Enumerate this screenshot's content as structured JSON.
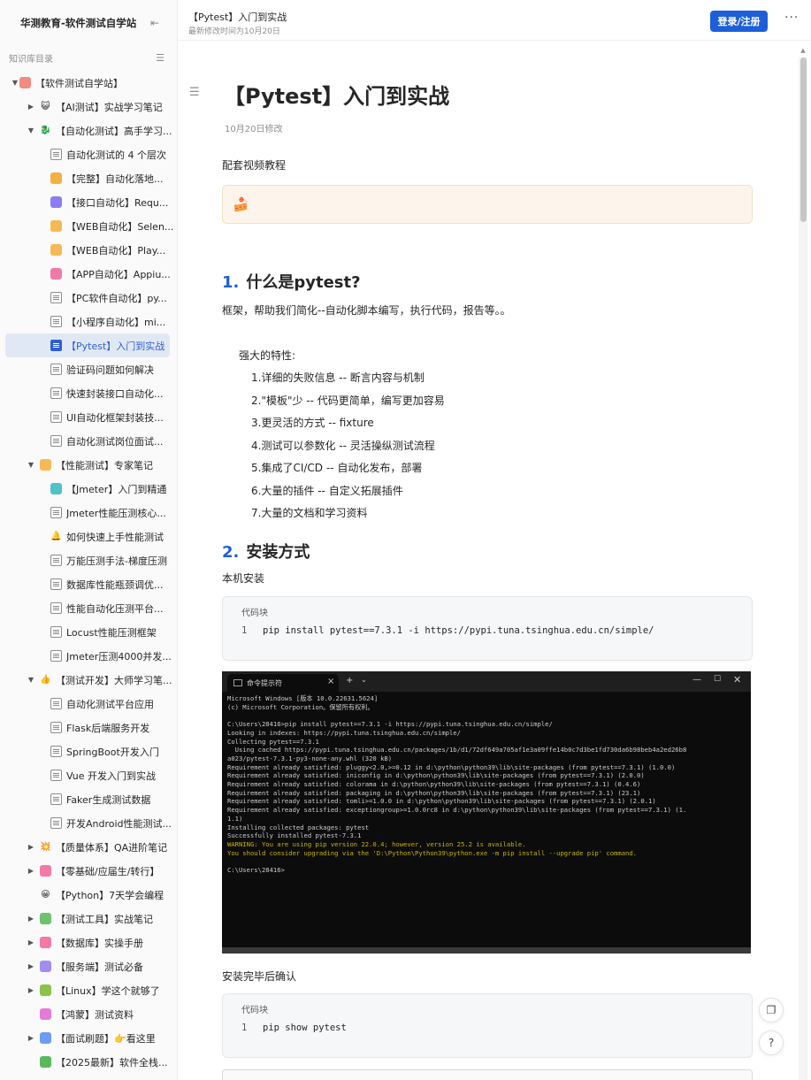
{
  "sidebar": {
    "title": "华测教育-软件测试自学站",
    "subtitle": "知识库目录",
    "items": [
      {
        "label": "【软件测试自学站】",
        "level": 0,
        "caret": "down",
        "icon": "root-icon",
        "icon_color": "#f28b82",
        "glyph": ""
      },
      {
        "label": "【AI测试】实战学习笔记",
        "level": 1,
        "caret": "right",
        "icon": "cat-icon",
        "icon_color": "",
        "glyph": "😺"
      },
      {
        "label": "【自动化测试】高手学习...",
        "level": 1,
        "caret": "down",
        "icon": "dragon-icon",
        "icon_color": "",
        "glyph": "🐉"
      },
      {
        "label": "自动化测试的 4 个层次",
        "level": 2,
        "caret": "",
        "icon": "doc",
        "icon_color": "",
        "glyph": ""
      },
      {
        "label": "【完整】自动化落地...",
        "level": 2,
        "caret": "",
        "icon": "orange-icon",
        "icon_color": "#f5b041",
        "glyph": ""
      },
      {
        "label": "【接口自动化】Requ...",
        "level": 2,
        "caret": "",
        "icon": "purple-icon",
        "icon_color": "#8e7cf5",
        "glyph": ""
      },
      {
        "label": "【WEB自动化】Selen...",
        "level": 2,
        "caret": "",
        "icon": "yellow-icon",
        "icon_color": "#f7b955",
        "glyph": ""
      },
      {
        "label": "【WEB自动化】Play...",
        "level": 2,
        "caret": "",
        "icon": "yellow-icon",
        "icon_color": "#f7b955",
        "glyph": ""
      },
      {
        "label": "【APP自动化】Appiu...",
        "level": 2,
        "caret": "",
        "icon": "pink-icon",
        "icon_color": "#f27aa6",
        "glyph": ""
      },
      {
        "label": "【PC软件自动化】py...",
        "level": 2,
        "caret": "",
        "icon": "doc",
        "icon_color": "",
        "glyph": ""
      },
      {
        "label": "【小程序自动化】mi...",
        "level": 2,
        "caret": "",
        "icon": "doc",
        "icon_color": "",
        "glyph": ""
      },
      {
        "label": "【Pytest】入门到实战",
        "level": 2,
        "caret": "",
        "icon": "doc-active",
        "icon_color": "",
        "glyph": "",
        "active": true
      },
      {
        "label": "验证码问题如何解决",
        "level": 2,
        "caret": "",
        "icon": "doc",
        "icon_color": "",
        "glyph": ""
      },
      {
        "label": "快速封装接口自动化...",
        "level": 2,
        "caret": "",
        "icon": "doc",
        "icon_color": "",
        "glyph": ""
      },
      {
        "label": "UI自动化框架封装技...",
        "level": 2,
        "caret": "",
        "icon": "doc",
        "icon_color": "",
        "glyph": ""
      },
      {
        "label": "自动化测试岗位面试...",
        "level": 2,
        "caret": "",
        "icon": "doc",
        "icon_color": "",
        "glyph": ""
      },
      {
        "label": "【性能测试】专家笔记",
        "level": 1,
        "caret": "down",
        "icon": "folder-icon",
        "icon_color": "#f7b955",
        "glyph": ""
      },
      {
        "label": "【Jmeter】入门到精通",
        "level": 2,
        "caret": "",
        "icon": "teal-icon",
        "icon_color": "#4fc3c8",
        "glyph": ""
      },
      {
        "label": "Jmeter性能压测核心...",
        "level": 2,
        "caret": "",
        "icon": "doc",
        "icon_color": "",
        "glyph": ""
      },
      {
        "label": "如何快速上手性能测试",
        "level": 2,
        "caret": "",
        "icon": "bell-icon",
        "icon_color": "",
        "glyph": "🔔"
      },
      {
        "label": "万能压测手法-梯度压测",
        "level": 2,
        "caret": "",
        "icon": "doc",
        "icon_color": "",
        "glyph": ""
      },
      {
        "label": "数据库性能瓶颈调优...",
        "level": 2,
        "caret": "",
        "icon": "doc",
        "icon_color": "",
        "glyph": ""
      },
      {
        "label": "性能自动化压测平台...",
        "level": 2,
        "caret": "",
        "icon": "doc",
        "icon_color": "",
        "glyph": ""
      },
      {
        "label": "Locust性能压测框架",
        "level": 2,
        "caret": "",
        "icon": "doc",
        "icon_color": "",
        "glyph": ""
      },
      {
        "label": "Jmeter压测4000并发...",
        "level": 2,
        "caret": "",
        "icon": "doc",
        "icon_color": "",
        "glyph": ""
      },
      {
        "label": "【测试开发】大师学习笔...",
        "level": 1,
        "caret": "down",
        "icon": "thumb-icon",
        "icon_color": "",
        "glyph": "👍"
      },
      {
        "label": "自动化测试平台应用",
        "level": 2,
        "caret": "",
        "icon": "doc",
        "icon_color": "",
        "glyph": ""
      },
      {
        "label": "Flask后端服务开发",
        "level": 2,
        "caret": "",
        "icon": "doc",
        "icon_color": "",
        "glyph": ""
      },
      {
        "label": "SpringBoot开发入门",
        "level": 2,
        "caret": "",
        "icon": "doc",
        "icon_color": "",
        "glyph": ""
      },
      {
        "label": "Vue 开发入门到实战",
        "level": 2,
        "caret": "",
        "icon": "doc",
        "icon_color": "",
        "glyph": ""
      },
      {
        "label": "Faker生成测试数据",
        "level": 2,
        "caret": "",
        "icon": "doc",
        "icon_color": "",
        "glyph": ""
      },
      {
        "label": "开发Android性能测试...",
        "level": 2,
        "caret": "",
        "icon": "doc",
        "icon_color": "",
        "glyph": ""
      },
      {
        "label": "【质量体系】QA进阶笔记",
        "level": 1,
        "caret": "right",
        "icon": "burst-icon",
        "icon_color": "",
        "glyph": "💥"
      },
      {
        "label": "【零基础/应届生/转行】",
        "level": 1,
        "caret": "right",
        "icon": "pink-icon",
        "icon_color": "#f27aa6",
        "glyph": ""
      },
      {
        "label": "【Python】7天学会编程",
        "level": 1,
        "caret": "",
        "icon": "smile-icon",
        "icon_color": "",
        "glyph": "😀"
      },
      {
        "label": "【测试工具】实战笔记",
        "level": 1,
        "caret": "right",
        "icon": "green-icon",
        "icon_color": "#6cc36c",
        "glyph": ""
      },
      {
        "label": "【数据库】实操手册",
        "level": 1,
        "caret": "right",
        "icon": "pink-icon",
        "icon_color": "#f27aa6",
        "glyph": ""
      },
      {
        "label": "【服务端】测试必备",
        "level": 1,
        "caret": "right",
        "icon": "purple-icon",
        "icon_color": "#a58cf0",
        "glyph": ""
      },
      {
        "label": "【Linux】学这个就够了",
        "level": 1,
        "caret": "right",
        "icon": "green-grid-icon",
        "icon_color": "#8bc34a",
        "glyph": ""
      },
      {
        "label": "【鸿蒙】测试资料",
        "level": 1,
        "caret": "",
        "icon": "magenta-icon",
        "icon_color": "#e57bd8",
        "glyph": ""
      },
      {
        "label": "【面试刷题】👉看这里",
        "level": 1,
        "caret": "right",
        "icon": "blue-icon",
        "icon_color": "#6f9cf2",
        "glyph": ""
      },
      {
        "label": "【2025最新】软件全栈...",
        "level": 1,
        "caret": "",
        "icon": "green-icon",
        "icon_color": "#5cb85c",
        "glyph": ""
      }
    ]
  },
  "topbar": {
    "title": "【Pytest】入门到实战",
    "subtitle": "最新修改时间为10月20日",
    "login_label": "登录/注册",
    "more_label": "···"
  },
  "doc": {
    "title": "【Pytest】入门到实战",
    "date": "10月20日修改",
    "video_label": "配套视频教程",
    "section1": {
      "num": "1.",
      "title": "什么是pytest?"
    },
    "intro": "框架，帮助我们简化--自动化脚本编写，执行代码，报告等。。",
    "features_title": "强大的特性:",
    "features": [
      "1.详细的失败信息 -- 断言内容与机制",
      "2.\"模板\"少 -- 代码更简单，编写更加容易",
      "3.更灵活的方式 -- fixture",
      "4.测试可以参数化 -- 灵活操纵测试流程",
      "5.集成了CI/CD -- 自动化发布，部署",
      "6.大量的插件 -- 自定义拓展插件",
      "7.大量的文档和学习资料"
    ],
    "section2": {
      "num": "2.",
      "title": "安装方式"
    },
    "local_install": "本机安装",
    "code1": {
      "label": "代码块",
      "line_no": "1",
      "code": "pip install pytest==7.3.1 -i https://pypi.tuna.tsinghua.edu.cn/simple/"
    },
    "confirm_label": "安装完毕后确认",
    "code2": {
      "label": "代码块",
      "line_no": "1",
      "code": "pip show pytest"
    }
  },
  "terminal": {
    "tab_title": "命令提示符",
    "lines": [
      "Microsoft Windows [版本 10.0.22631.5624]",
      "(c) Microsoft Corporation。保留所有权利。",
      "",
      "C:\\Users\\28416>pip install pytest==7.3.1 -i https://pypi.tuna.tsinghua.edu.cn/simple/",
      "Looking in indexes: https://pypi.tuna.tsinghua.edu.cn/simple/",
      "Collecting pytest==7.3.1",
      "  Using cached https://pypi.tuna.tsinghua.edu.cn/packages/1b/d1/72df649a705af1e3a09ffe14b0c7d3be1fd730da6b98beb4a2ed26b8",
      "a023/pytest-7.3.1-py3-none-any.whl (320 kB)",
      "Requirement already satisfied: pluggy<2.0,>=0.12 in d:\\python\\python39\\lib\\site-packages (from pytest==7.3.1) (1.0.0)",
      "Requirement already satisfied: iniconfig in d:\\python\\python39\\lib\\site-packages (from pytest==7.3.1) (2.0.0)",
      "Requirement already satisfied: colorama in d:\\python\\python39\\lib\\site-packages (from pytest==7.3.1) (0.4.6)",
      "Requirement already satisfied: packaging in d:\\python\\python39\\lib\\site-packages (from pytest==7.3.1) (23.1)",
      "Requirement already satisfied: tomli>=1.0.0 in d:\\python\\python39\\lib\\site-packages (from pytest==7.3.1) (2.0.1)",
      "Requirement already satisfied: exceptiongroup>=1.0.0rc8 in d:\\python\\python39\\lib\\site-packages (from pytest==7.3.1) (1.",
      "1.1)",
      "Installing collected packages: pytest",
      "Successfully installed pytest-7.3.1",
      "WARNING: You are using pip version 22.0.4; however, version 25.2 is available.",
      "You should consider upgrading via the 'D:\\Python\\Python39\\python.exe -m pip install --upgrade pip' command.",
      "",
      "C:\\Users\\28416>"
    ],
    "warn_lines": [
      17,
      18
    ]
  },
  "colors": {
    "accent": "#1d5fd8",
    "active_bg": "#e1e8f5",
    "video_bg": "#fdf5eb"
  }
}
